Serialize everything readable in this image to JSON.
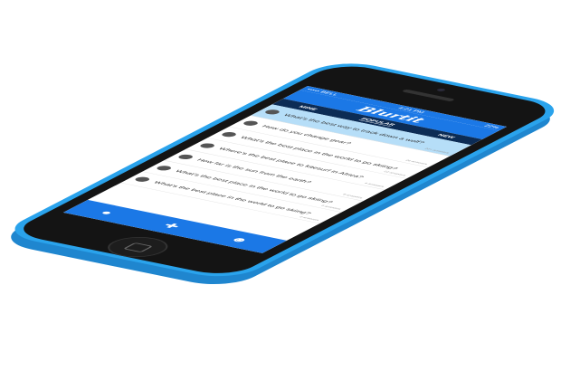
{
  "status_bar": {
    "carrier": "••••• BELL",
    "time": "4:21 PM",
    "battery": "22%"
  },
  "app_title": "Blurtit",
  "tabs": [
    "MINE",
    "POPULAR",
    "NEW"
  ],
  "questions": [
    {
      "text": "What's the best way to track down a wolf?",
      "answers": "20+ answers",
      "highlighted": true
    },
    {
      "text": "How do you change gear?",
      "answers": "26 answers"
    },
    {
      "text": "What's the best place in the world to go skiing?",
      "answers": "22 answers"
    },
    {
      "text": "Where's the best place to kitesurf in Africa?",
      "answers": "4 answers"
    },
    {
      "text": "How far is the sun from the earth?",
      "answers": "8 answers"
    },
    {
      "text": "What's the best place in the world to go skiing?",
      "answers": "3 answers"
    },
    {
      "text": "What's the best place in the world to go skiing?",
      "answers": "2 answers"
    }
  ],
  "bottom_bar": {
    "icons": [
      "chat-icon",
      "ask-cross-icon",
      "profile-icon"
    ]
  },
  "colors": {
    "brand": "#1b78e6",
    "nav": "#0c2c55",
    "highlight": "#b6def8",
    "phone": "#2aa3ec"
  }
}
